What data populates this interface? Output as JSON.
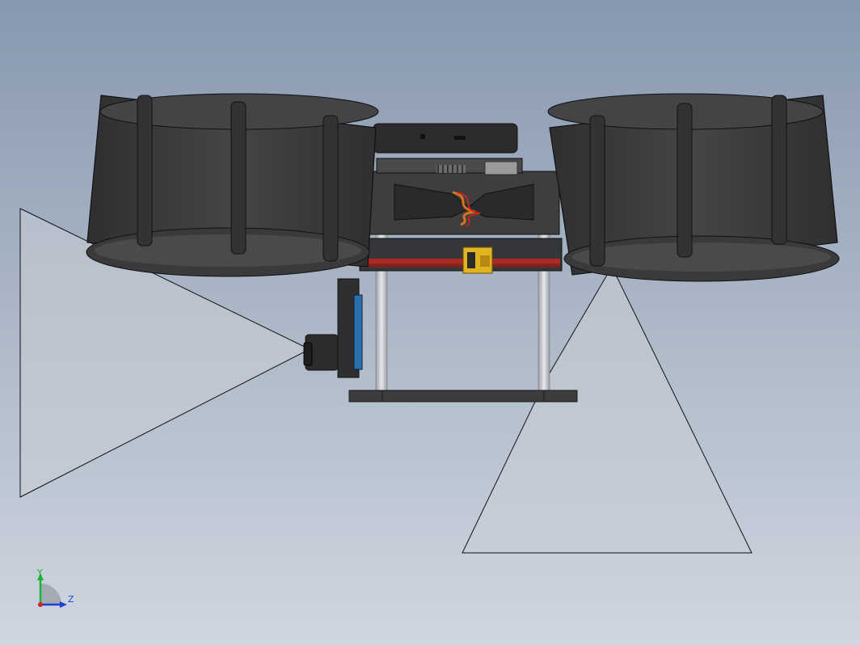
{
  "viewport": {
    "background_top": "#8798af",
    "background_bottom": "#cfd6e0"
  },
  "model": {
    "body_color": "#3b3b3d",
    "body_dark": "#2a2a2c",
    "frame_color": "#4a4a4c",
    "rod_color": "#c9ccd2",
    "fov_fill": "#c7ccd4",
    "wire_red": "#c0281e",
    "wire_orange": "#d9741c",
    "connector_yellow": "#e0b321",
    "camera_board_blue": "#2a6fae"
  },
  "triad": {
    "y_label": "Y",
    "z_label": "Z",
    "y_color": "#1bb33a",
    "z_color": "#1f3fd6",
    "origin_color": "#d4222a"
  }
}
